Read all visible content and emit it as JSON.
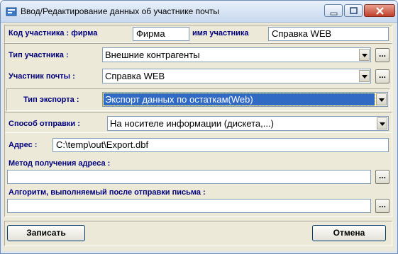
{
  "window": {
    "title": "Ввод/Редактирование данных об участнике почты"
  },
  "form": {
    "code_label": "Код участника : фирма",
    "code_value": "Фирма",
    "name_label": "имя участника",
    "name_value": "Справка WEB",
    "type_label": "Тип участника :",
    "type_value": "Внешние контрагенты",
    "member_label": "Участник почты :",
    "member_value": "Справка WEB",
    "export_label": "Тип экспорта :",
    "export_value": "Экспорт данных по остаткам(Web)",
    "send_label": "Способ отправки :",
    "send_value": "На носителе информации (дискета,...)",
    "address_label": "Адрес :",
    "address_value": "C:\\temp\\out\\Export.dbf",
    "method_label": "Метод получения адреса :",
    "method_value": "",
    "algo_label": "Алгоритм, выполняемый после отправки письма :",
    "algo_value": "",
    "ellipsis": "..."
  },
  "buttons": {
    "save": "Записать",
    "cancel": "Отмена"
  }
}
